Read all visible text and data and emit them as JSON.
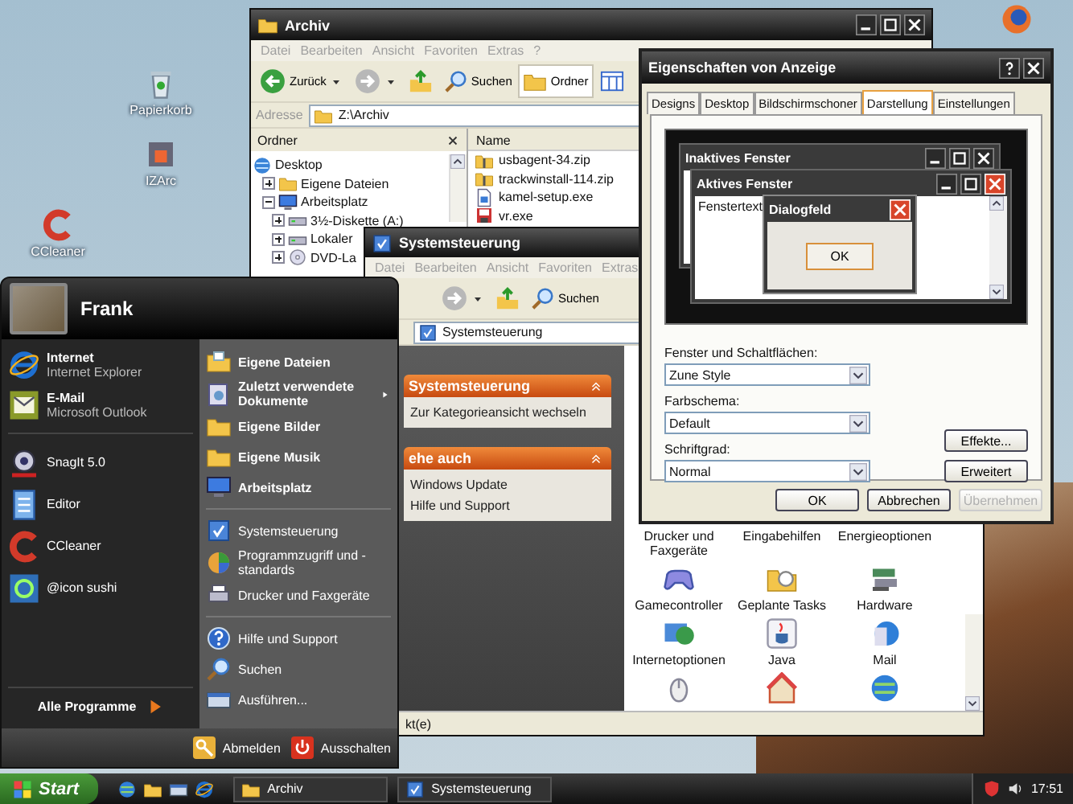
{
  "desktop_icons": [
    {
      "label": "Papierkorb",
      "kind": "trash"
    },
    {
      "label": "IZArc",
      "kind": "box"
    },
    {
      "label": "CCleaner",
      "kind": "cleaner"
    },
    {
      "kind": "firefox"
    }
  ],
  "archive": {
    "title": "Archiv",
    "menu": [
      "Datei",
      "Bearbeiten",
      "Ansicht",
      "Favoriten",
      "Extras",
      "?"
    ],
    "toolbar": [
      {
        "kind": "back",
        "label": "Zurück",
        "selected": false
      },
      {
        "kind": "forward",
        "selected": false
      },
      {
        "kind": "up",
        "selected": false
      },
      {
        "kind": "search",
        "label": "Suchen",
        "selected": false
      },
      {
        "kind": "folder",
        "label": "Ordner",
        "selected": true
      },
      {
        "kind": "views",
        "selected": false
      }
    ],
    "address_label": "Adresse",
    "address": "Z:\\Archiv",
    "folders_pane": {
      "title": "Ordner",
      "tree": [
        {
          "label": "Desktop",
          "kind": "desktop",
          "children": [
            {
              "label": "Eigene Dateien",
              "kind": "folder",
              "expanded": false
            },
            {
              "label": "Arbeitsplatz",
              "kind": "computer",
              "expanded": true,
              "children": [
                {
                  "label": "3½-Diskette (A:)",
                  "kind": "drive",
                  "expanded": false
                },
                {
                  "label": "Lokaler",
                  "kind": "drive",
                  "expanded": false
                },
                {
                  "label": "DVD-La",
                  "kind": "dvd",
                  "expanded": false
                }
              ]
            }
          ]
        }
      ]
    },
    "files": {
      "column": "Name",
      "items": [
        {
          "name": "usbagent-34.zip",
          "kind": "zip"
        },
        {
          "name": "trackwinstall-114.zip",
          "kind": "zip"
        },
        {
          "name": "kamel-setup.exe",
          "kind": "setup"
        },
        {
          "name": "vr.exe",
          "kind": "exe"
        }
      ]
    }
  },
  "control_panel": {
    "title": "Systemsteuerung",
    "menu": [
      "Datei",
      "Bearbeiten",
      "Ansicht",
      "Favoriten",
      "Extras"
    ],
    "toolbar": [
      {
        "kind": "forward"
      },
      {
        "kind": "up"
      },
      {
        "kind": "search",
        "label": "Suchen"
      }
    ],
    "address": "Systemsteuerung",
    "task_panels": [
      {
        "title": "Systemsteuerung",
        "links": [
          "Zur Kategorieansicht wechseln"
        ]
      },
      {
        "title": "ehe auch",
        "links": [
          "Windows Update",
          "Hilfe und Support"
        ]
      }
    ],
    "items": [
      {
        "label": "Drucker und Faxgeräte"
      },
      {
        "label": "Eingabehilfen"
      },
      {
        "label": "Energieoptionen"
      },
      {
        "label": "Gamecontroller",
        "kind": "gamepad"
      },
      {
        "label": "Geplante Tasks",
        "kind": "tasks"
      },
      {
        "label": "Hardware",
        "kind": "hardware"
      },
      {
        "label": "Internetoptionen",
        "kind": "netopt"
      },
      {
        "label": "Java",
        "kind": "java"
      },
      {
        "label": "Mail",
        "kind": "mailcp"
      },
      {
        "kind": "mouse"
      },
      {
        "kind": "house"
      },
      {
        "kind": "globe"
      }
    ],
    "status": "kt(e)"
  },
  "display_dialog": {
    "title": "Eigenschaften von Anzeige",
    "tabs": [
      {
        "label": "Designs",
        "selected": false
      },
      {
        "label": "Desktop",
        "selected": false
      },
      {
        "label": "Bildschirmschoner",
        "selected": false
      },
      {
        "label": "Darstellung",
        "selected": true
      },
      {
        "label": "Einstellungen",
        "selected": false
      }
    ],
    "preview": {
      "inactive_title": "Inaktives Fenster",
      "active_title": "Aktives Fenster",
      "window_text": "Fenstertext",
      "message_title": "Dialogfeld",
      "message_button": "OK"
    },
    "fields": [
      {
        "label": "Fenster und Schaltflächen:",
        "value": "Zune Style"
      },
      {
        "label": "Farbschema:",
        "value": "Default"
      },
      {
        "label": "Schriftgrad:",
        "value": "Normal"
      }
    ],
    "side_buttons": [
      "Effekte...",
      "Erweitert"
    ],
    "buttons": [
      {
        "label": "OK",
        "disabled": false
      },
      {
        "label": "Abbrechen",
        "disabled": false
      },
      {
        "label": "Übernehmen",
        "disabled": true
      }
    ]
  },
  "start_menu": {
    "user": "Frank",
    "pinned": [
      {
        "title": "Internet",
        "subtitle": "Internet Explorer",
        "kind": "ie"
      },
      {
        "title": "E-Mail",
        "subtitle": "Microsoft Outlook",
        "kind": "envelope"
      }
    ],
    "recent": [
      {
        "label": "SnagIt 5.0",
        "kind": "snagit"
      },
      {
        "label": "Editor",
        "kind": "notepad"
      },
      {
        "label": "CCleaner",
        "kind": "cleaner"
      },
      {
        "label": "@icon sushi",
        "kind": "tile"
      }
    ],
    "all_programs": "Alle Programme",
    "groups": [
      {
        "bold": true,
        "items": [
          {
            "label": "Eigene Dateien",
            "kind": "docs",
            "submenu": false
          },
          {
            "label": "Zuletzt verwendete Dokumente",
            "kind": "recent",
            "submenu": true
          },
          {
            "label": "Eigene Bilder",
            "kind": "folder",
            "submenu": false
          },
          {
            "label": "Eigene Musik",
            "kind": "folder",
            "submenu": false
          },
          {
            "label": "Arbeitsplatz",
            "kind": "computer",
            "submenu": false
          }
        ]
      },
      {
        "bold": false,
        "items": [
          {
            "label": "Systemsteuerung",
            "kind": "panel",
            "submenu": false
          },
          {
            "label": "Programmzugriff und -standards",
            "kind": "programs",
            "submenu": false
          },
          {
            "label": "Drucker und Faxgeräte",
            "kind": "printer",
            "submenu": false
          }
        ]
      },
      {
        "bold": false,
        "items": [
          {
            "label": "Hilfe und Support",
            "kind": "help",
            "submenu": false
          },
          {
            "label": "Suchen",
            "kind": "search",
            "submenu": false
          },
          {
            "label": "Ausführen...",
            "kind": "run",
            "submenu": false
          }
        ]
      }
    ],
    "logoff": "Abmelden",
    "shutdown": "Ausschalten"
  },
  "taskbar": {
    "start": "Start",
    "quick_launch": [
      {
        "kind": "globe"
      },
      {
        "kind": "folder"
      },
      {
        "kind": "run"
      },
      {
        "kind": "ie"
      }
    ],
    "tasks": [
      {
        "label": "Archiv",
        "kind": "folder",
        "selected": false
      },
      {
        "label": "Systemsteuerung",
        "kind": "panel",
        "selected": false
      }
    ],
    "tray": [
      {
        "kind": "shield"
      },
      {
        "kind": "speaker"
      }
    ],
    "clock": "17:51"
  }
}
